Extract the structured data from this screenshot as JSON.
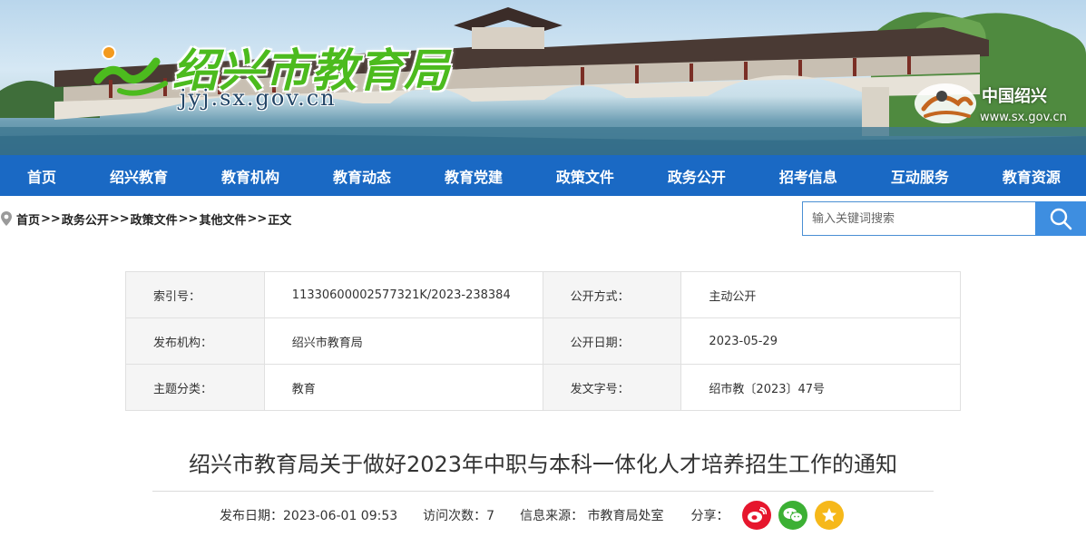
{
  "banner": {
    "logo_text": "绍兴市教育局",
    "logo_url": "jyj.sx.gov.cn",
    "city_logo_name": "中国绍兴",
    "city_logo_url": "www.sx.gov.cn"
  },
  "nav": {
    "items": [
      "首页",
      "绍兴教育",
      "教育机构",
      "教育动态",
      "教育党建",
      "政策文件",
      "政务公开",
      "招考信息",
      "互动服务",
      "教育资源"
    ]
  },
  "breadcrumb": {
    "items": [
      "首页",
      "政务公开",
      "政策文件",
      "其他文件",
      "正文"
    ],
    "separator": ">>"
  },
  "search": {
    "placeholder": "输入关键词搜索"
  },
  "info_table": {
    "index_label": "索引号：",
    "index_value": "11330600002577321K/2023-238384",
    "open_method_label": "公开方式：",
    "open_method_value": "主动公开",
    "publisher_label": "发布机构：",
    "publisher_value": "绍兴市教育局",
    "open_date_label": "公开日期：",
    "open_date_value": "2023-05-29",
    "topic_label": "主题分类：",
    "topic_value": "教育",
    "doc_no_label": "发文字号：",
    "doc_no_value": "绍市教〔2023〕47号"
  },
  "article": {
    "title": "绍兴市教育局关于做好2023年中职与本科一体化人才培养招生工作的通知",
    "publish_date": "发布日期：2023-06-01 09:53",
    "visits": "访问次数：7",
    "source": "信息来源： 市教育局处室",
    "share_label": "分享："
  },
  "colors": {
    "nav_blue": "#1a69c4",
    "logo_green": "#4cbb1e",
    "weibo_red": "#e6162d",
    "wechat_green": "#3cb034",
    "star_yellow": "#f6b81a"
  }
}
